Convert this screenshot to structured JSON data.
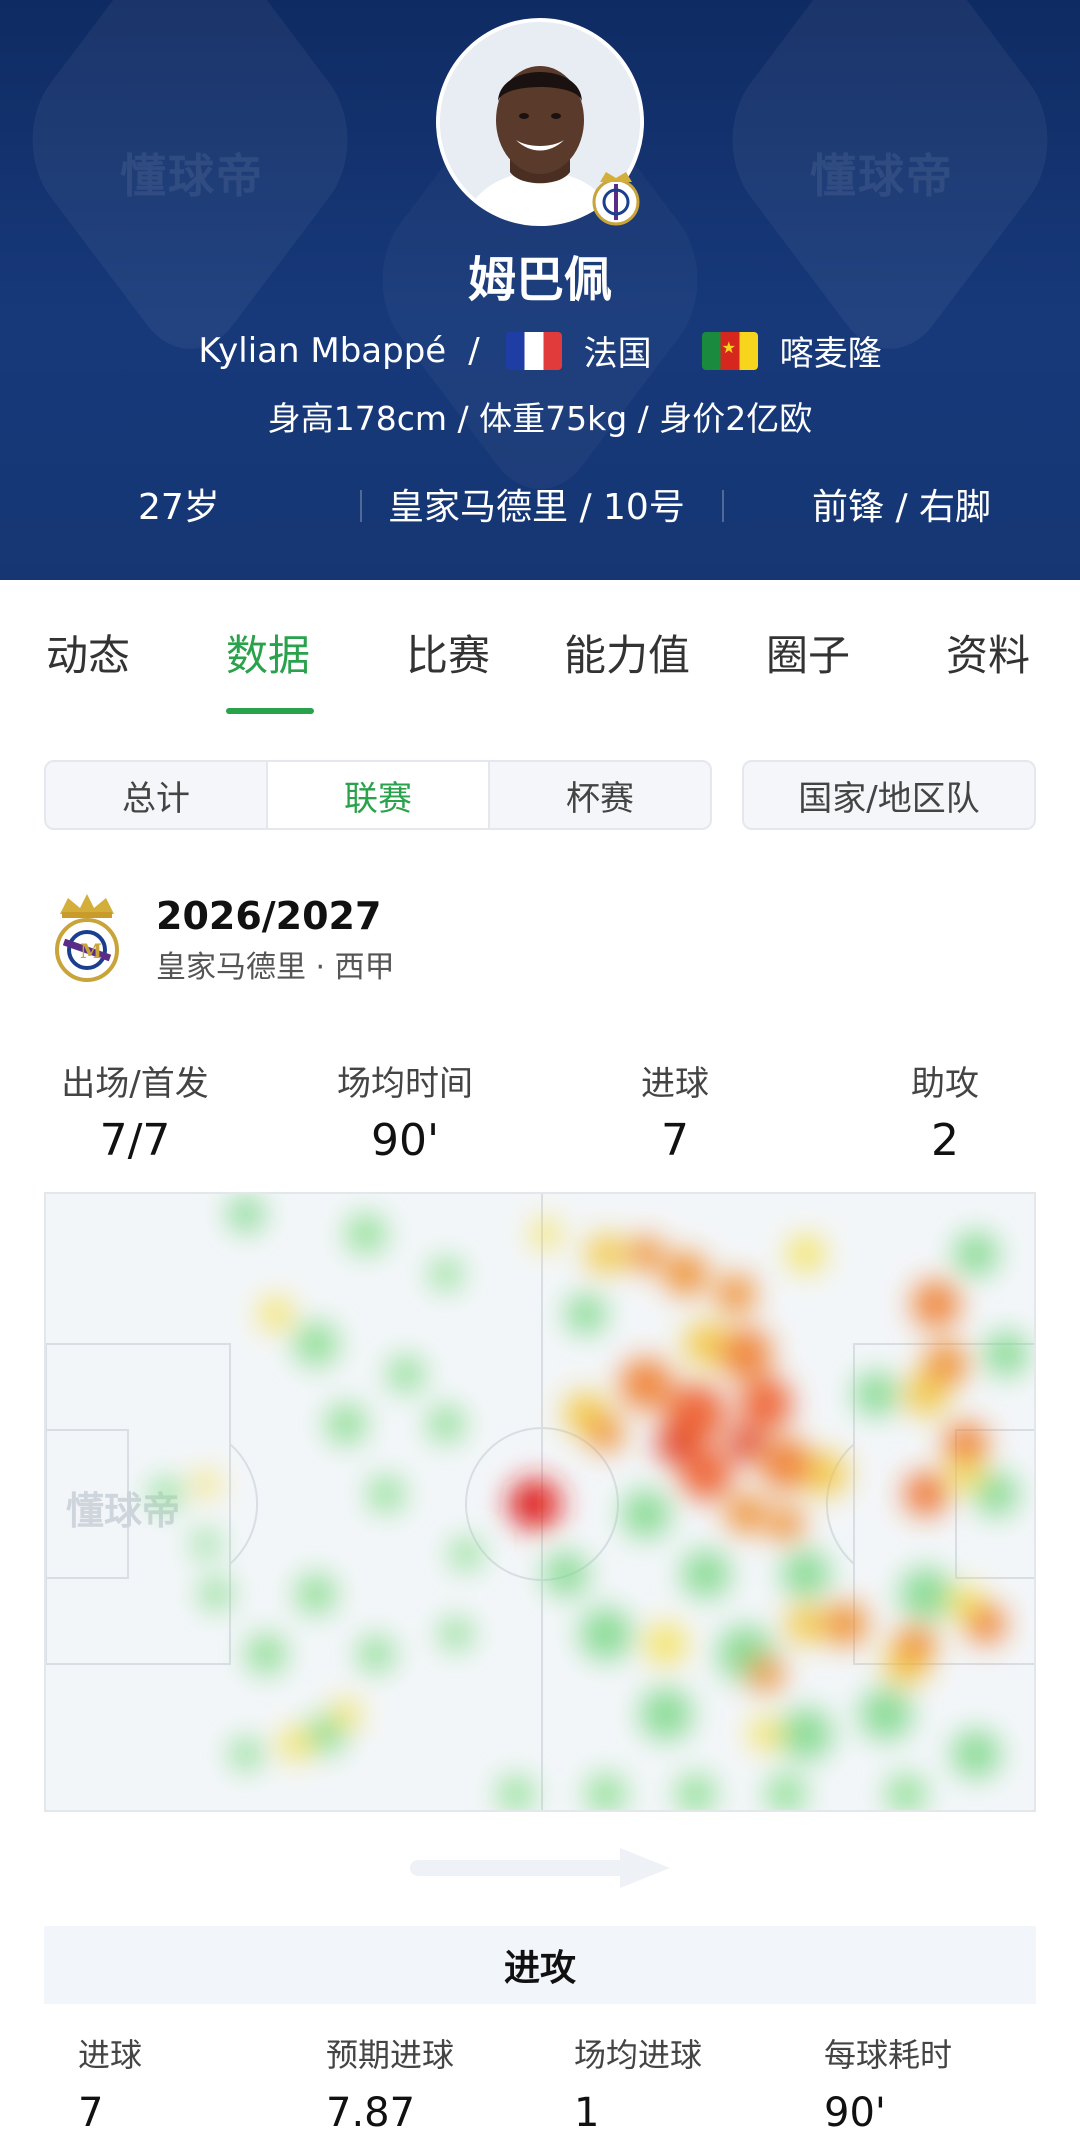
{
  "header": {
    "name_cn": "姆巴佩",
    "name_en": "Kylian Mbappé",
    "sep": "/",
    "nationality_1": "法国",
    "nationality_2": "喀麦隆",
    "physical": "身高178cm / 体重75kg / 身价2亿欧",
    "age": "27岁",
    "club_number": "皇家马德里 / 10号",
    "position_foot": "前锋 / 右脚",
    "watermark": "懂球帝"
  },
  "tabs": [
    {
      "label": "动态"
    },
    {
      "label": "数据"
    },
    {
      "label": "比赛"
    },
    {
      "label": "能力值"
    },
    {
      "label": "圈子"
    },
    {
      "label": "资料"
    }
  ],
  "segments": {
    "total": "总计",
    "league": "联赛",
    "cup": "杯赛",
    "national": "国家/地区队"
  },
  "season": {
    "year": "2026/2027",
    "league": "皇家马德里 · 西甲"
  },
  "key_stats": [
    {
      "label": "出场/首发",
      "value": "7/7"
    },
    {
      "label": "场均时间",
      "value": "90'"
    },
    {
      "label": "进球",
      "value": "7"
    },
    {
      "label": "助攻",
      "value": "2"
    }
  ],
  "attack": {
    "title": "进攻",
    "stats": [
      {
        "label": "进球",
        "value": "7"
      },
      {
        "label": "预期进球",
        "value": "7.87"
      },
      {
        "label": "场均进球",
        "value": "1"
      },
      {
        "label": "每球耗时",
        "value": "90'"
      }
    ]
  },
  "colors": {
    "accent": "#2aa24b",
    "header_bg": "#163673"
  }
}
